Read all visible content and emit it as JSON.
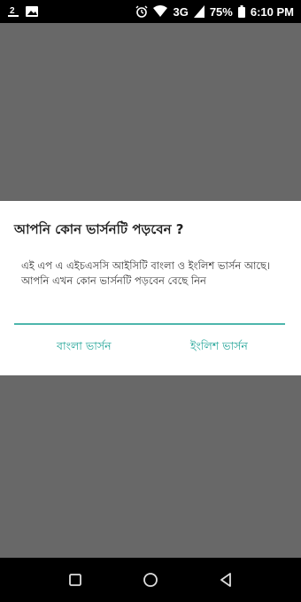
{
  "status_bar": {
    "left_badge": "2",
    "battery": "75%",
    "network": "3G",
    "time": "6:10 PM",
    "icons": [
      "notification-badge-icon",
      "image-icon",
      "alarm-icon",
      "wifi-icon",
      "signal-icon",
      "battery-icon"
    ]
  },
  "dialog": {
    "title": "আপনি কোন ভার্সনটি পড়বেন ?",
    "message": "এই এপ এ এইচএসসি আইসিটি বাংলা ও ইংলিশ ভার্সন আছে। আপনি এখন কোন ভার্সনটি পড়বেন বেছে নিন",
    "button_bangla": "বাংলা ভার্সন",
    "button_english": "ইংলিশ ভার্সন"
  },
  "colors": {
    "accent": "#26a69a",
    "divider": "#4db6ac",
    "scrim": "#686868",
    "bars": "#000000"
  },
  "nav_bar": {
    "icons": [
      "recent-apps-icon",
      "home-icon",
      "back-icon"
    ]
  }
}
